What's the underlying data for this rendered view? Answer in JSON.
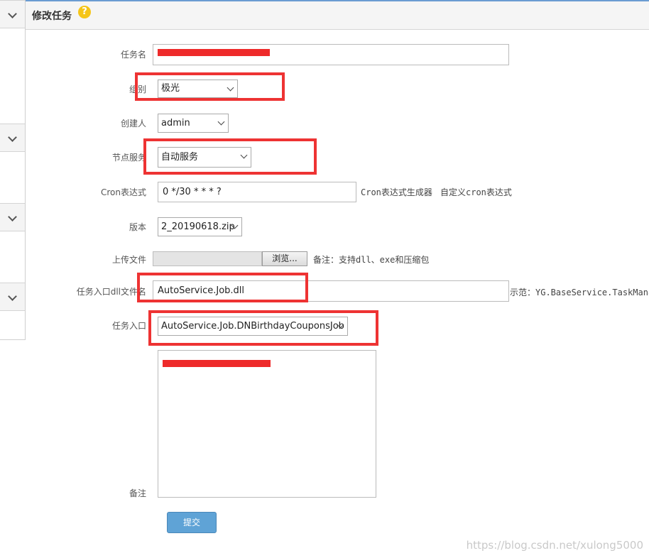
{
  "header": {
    "title": "修改任务",
    "help_glyph": "?"
  },
  "sidebar": {
    "sections": [
      "chevron-down",
      "chevron-down",
      "chevron-down",
      "chevron-down"
    ]
  },
  "form": {
    "task_name": {
      "label": "任务名",
      "value": ""
    },
    "group": {
      "label": "组别",
      "value": "极光"
    },
    "creator": {
      "label": "创建人",
      "value": "admin"
    },
    "node_service": {
      "label": "节点服务",
      "value": "自动服务"
    },
    "cron": {
      "label": "Cron表达式",
      "value": "0 */30 * * * ?",
      "generator_link": "Cron表达式生成器",
      "custom_link": "自定义cron表达式"
    },
    "version": {
      "label": "版本",
      "value": "2_20190618.zip"
    },
    "upload": {
      "label": "上传文件",
      "browse_label": "浏览...",
      "note": "备注：支持dll、exe和压缩包"
    },
    "dll_file": {
      "label": "任务入口dll文件名",
      "value": "AutoService.Job.dll",
      "example": "示范：YG.BaseService.TaskManage"
    },
    "entry": {
      "label": "任务入口",
      "value": "AutoService.Job.DNBirthdayCouponsJob"
    },
    "remark": {
      "label": "备注",
      "value": ""
    },
    "submit_label": "提交"
  },
  "watermark": "https://blog.csdn.net/xulong5000",
  "colors": {
    "accent": "#5fa3d6",
    "highlight": "#ee3333",
    "help": "#f5c518"
  }
}
